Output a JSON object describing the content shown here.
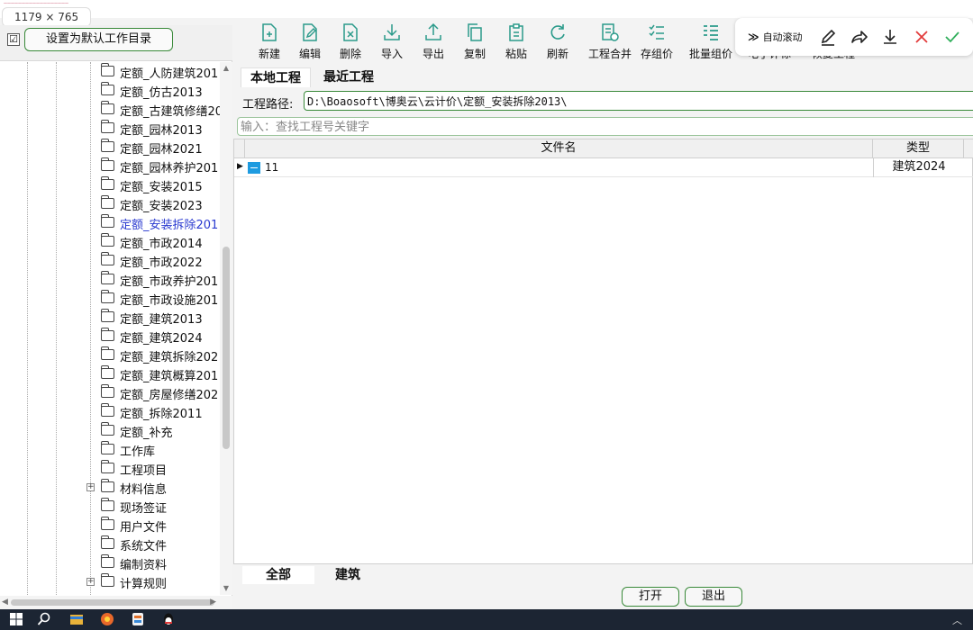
{
  "screenshot": {
    "dimension_badge": "1179 × 765",
    "strip_title": "一一一一一一一一一一一一一一一一一一"
  },
  "left": {
    "default_dir_button": "设置为默认工作目录",
    "default_checked": "☑",
    "tree_items": [
      {
        "label": "定额_人防建筑201",
        "selected": false,
        "expandable": false
      },
      {
        "label": "定额_仿古2013",
        "selected": false,
        "expandable": false
      },
      {
        "label": "定额_古建筑修缮20",
        "selected": false,
        "expandable": false
      },
      {
        "label": "定额_园林2013",
        "selected": false,
        "expandable": false
      },
      {
        "label": "定额_园林2021",
        "selected": false,
        "expandable": false
      },
      {
        "label": "定额_园林养护201",
        "selected": false,
        "expandable": false
      },
      {
        "label": "定额_安装2015",
        "selected": false,
        "expandable": false
      },
      {
        "label": "定额_安装2023",
        "selected": false,
        "expandable": false
      },
      {
        "label": "定额_安装拆除201",
        "selected": true,
        "expandable": false
      },
      {
        "label": "定额_市政2014",
        "selected": false,
        "expandable": false
      },
      {
        "label": "定额_市政2022",
        "selected": false,
        "expandable": false
      },
      {
        "label": "定额_市政养护201",
        "selected": false,
        "expandable": false
      },
      {
        "label": "定额_市政设施201",
        "selected": false,
        "expandable": false
      },
      {
        "label": "定额_建筑2013",
        "selected": false,
        "expandable": false
      },
      {
        "label": "定额_建筑2024",
        "selected": false,
        "expandable": false
      },
      {
        "label": "定额_建筑拆除202",
        "selected": false,
        "expandable": false
      },
      {
        "label": "定额_建筑概算201",
        "selected": false,
        "expandable": false
      },
      {
        "label": "定额_房屋修缮202",
        "selected": false,
        "expandable": false
      },
      {
        "label": "定额_拆除2011",
        "selected": false,
        "expandable": false
      },
      {
        "label": "定额_补充",
        "selected": false,
        "expandable": false
      },
      {
        "label": "工作库",
        "selected": false,
        "expandable": false
      },
      {
        "label": "工程项目",
        "selected": false,
        "expandable": false
      },
      {
        "label": "材料信息",
        "selected": false,
        "expandable": true
      },
      {
        "label": "现场签证",
        "selected": false,
        "expandable": false
      },
      {
        "label": "用户文件",
        "selected": false,
        "expandable": false
      },
      {
        "label": "系统文件",
        "selected": false,
        "expandable": false
      },
      {
        "label": "编制资料",
        "selected": false,
        "expandable": false
      },
      {
        "label": "计算规则",
        "selected": false,
        "expandable": true
      }
    ]
  },
  "toolbar": {
    "buttons": [
      {
        "label": "新建",
        "icon": "new-file-icon"
      },
      {
        "label": "编辑",
        "icon": "edit-icon"
      },
      {
        "label": "删除",
        "icon": "delete-icon"
      },
      {
        "label": "导入",
        "icon": "import-icon"
      },
      {
        "label": "导出",
        "icon": "export-icon"
      },
      {
        "label": "复制",
        "icon": "copy-icon"
      },
      {
        "label": "粘贴",
        "icon": "paste-icon"
      },
      {
        "label": "刷新",
        "icon": "refresh-icon"
      },
      {
        "label": "工程合并",
        "icon": "merge-icon"
      },
      {
        "label": "存组价",
        "icon": "save-price-icon"
      },
      {
        "label": "批量组价",
        "icon": "batch-price-icon"
      },
      {
        "label": "电子评标",
        "icon": "e-bid-icon"
      },
      {
        "label": "恢复工程",
        "icon": "restore-icon"
      }
    ]
  },
  "floatbar": {
    "auto_scroll": "自动滚动",
    "chevron": "≫"
  },
  "tabs": {
    "local": "本地工程",
    "recent": "最近工程"
  },
  "path": {
    "label": "工程路径:",
    "value": "D:\\Boaosoft\\博奥云\\云计价\\定额_安装拆除2013\\"
  },
  "search": {
    "placeholder": "输入：查找工程号关键字"
  },
  "grid": {
    "col_name": "文件名",
    "col_type": "类型",
    "rows": [
      {
        "name": "11",
        "type": "建筑2024"
      }
    ]
  },
  "categories": {
    "all": "全部",
    "build": "建筑"
  },
  "actions": {
    "open": "打开",
    "exit": "退出"
  },
  "colors": {
    "accent_green": "#3a8a3a",
    "selection_blue": "#2a3ad0",
    "row_icon": "#1e9be0"
  }
}
